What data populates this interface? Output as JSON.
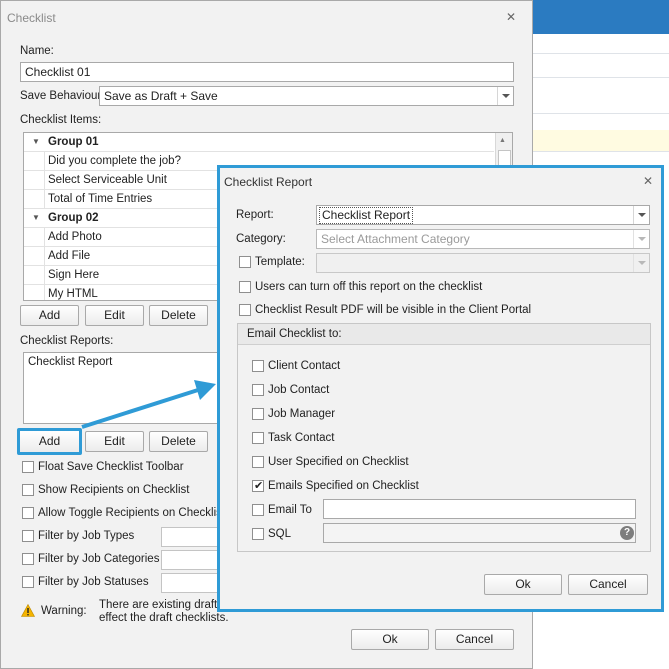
{
  "main": {
    "title": "Checklist",
    "close": "✕",
    "name_label": "Name:",
    "name_value": "Checklist 01",
    "save_behaviour_label": "Save Behaviour",
    "save_behaviour_value": "Save as Draft + Save",
    "items_label": "Checklist Items:",
    "items": [
      {
        "kind": "group",
        "text": "Group 01"
      },
      {
        "kind": "item",
        "text": "Did you complete the job?"
      },
      {
        "kind": "item",
        "text": "Select Serviceable Unit"
      },
      {
        "kind": "item",
        "text": "Total of Time Entries"
      },
      {
        "kind": "group",
        "text": "Group 02"
      },
      {
        "kind": "item",
        "text": "Add Photo"
      },
      {
        "kind": "item",
        "text": "Add File"
      },
      {
        "kind": "item",
        "text": "Sign Here"
      },
      {
        "kind": "item",
        "text": "My HTML"
      }
    ],
    "items_buttons": {
      "add": "Add",
      "edit": "Edit",
      "delete": "Delete"
    },
    "reports_label": "Checklist Reports:",
    "reports": [
      "Checklist Report"
    ],
    "reports_buttons": {
      "add": "Add",
      "edit": "Edit",
      "delete": "Delete"
    },
    "checkboxes": [
      "Float Save Checklist Toolbar",
      "Show Recipients on Checklist",
      "Allow Toggle Recipients on Checklist",
      "Filter by Job Types",
      "Filter by Job Categories",
      "Filter by Job Statuses"
    ],
    "warning_label": "Warning:",
    "warning_line1": "There are existing draft",
    "warning_line2": "effect the draft checklists.",
    "ok": "Ok",
    "cancel": "Cancel"
  },
  "report": {
    "title": "Checklist Report",
    "close": "✕",
    "report_label": "Report:",
    "report_value": "Checklist Report",
    "category_label": "Category:",
    "category_placeholder": "Select Attachment Category",
    "template_label": "Template:",
    "turn_off_label": "Users can turn off this report on the checklist",
    "pdf_visible_label": "Checklist Result PDF will be visible in the Client Portal",
    "email_group_title": "Email Checklist to:",
    "email_options": [
      {
        "label": "Client Contact",
        "checked": false
      },
      {
        "label": "Job Contact",
        "checked": false
      },
      {
        "label": "Job Manager",
        "checked": false
      },
      {
        "label": "Task Contact",
        "checked": false
      },
      {
        "label": "User Specified on Checklist",
        "checked": false
      },
      {
        "label": "Emails Specified on Checklist",
        "checked": true
      }
    ],
    "email_to_label": "Email To",
    "sql_label": "SQL",
    "help": "?",
    "ok": "Ok",
    "cancel": "Cancel"
  },
  "colors": {
    "accent": "#2f9bd6"
  }
}
